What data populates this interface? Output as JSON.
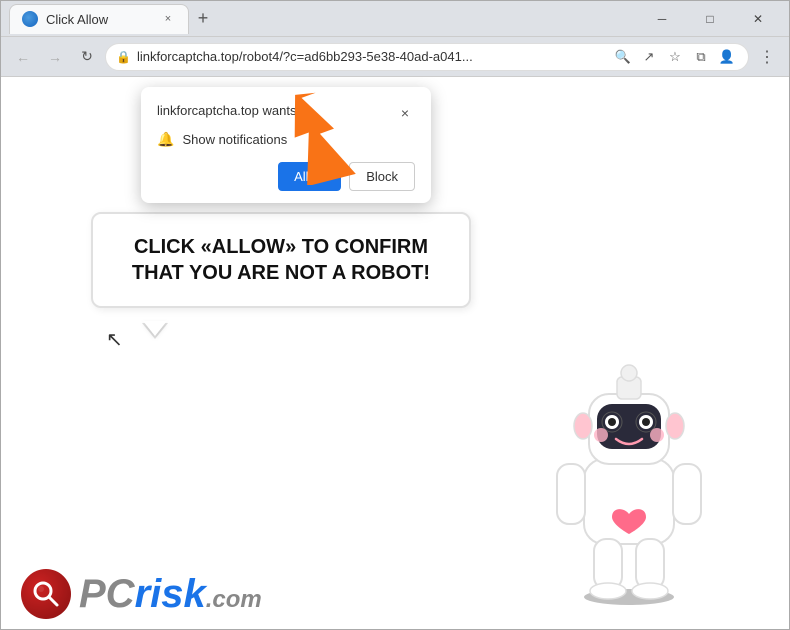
{
  "browser": {
    "tab": {
      "favicon_alt": "site-favicon",
      "title": "Click Allow",
      "close_label": "×"
    },
    "new_tab_label": "+",
    "window_controls": {
      "minimize": "─",
      "maximize": "□",
      "close": "✕"
    },
    "nav": {
      "back": "←",
      "forward": "→",
      "reload": "↻"
    },
    "address": {
      "lock_icon": "🔒",
      "url": "linkforcaptcha.top/robot4/?c=ad6bb293-5e38-40ad-a041..."
    },
    "address_icons": {
      "search": "🔍",
      "share": "↗",
      "bookmark": "☆",
      "extensions": "⧉",
      "profile": "👤",
      "menu": "⋮"
    }
  },
  "notification_popup": {
    "title": "linkforcaptcha.top wants to",
    "close_label": "×",
    "notification_label": "Show notifications",
    "allow_label": "Allow",
    "block_label": "Block"
  },
  "speech_bubble": {
    "text": "CLICK «ALLOW» TO CONFIRM THAT YOU ARE NOT A ROBOT!"
  },
  "pcrisk": {
    "text_gray": "PC",
    "text_blue": "risk",
    "suffix": ".com"
  },
  "colors": {
    "allow_btn": "#1a73e8",
    "orange_arrow": "#f97316",
    "bubble_border": "#e0e0e0"
  }
}
